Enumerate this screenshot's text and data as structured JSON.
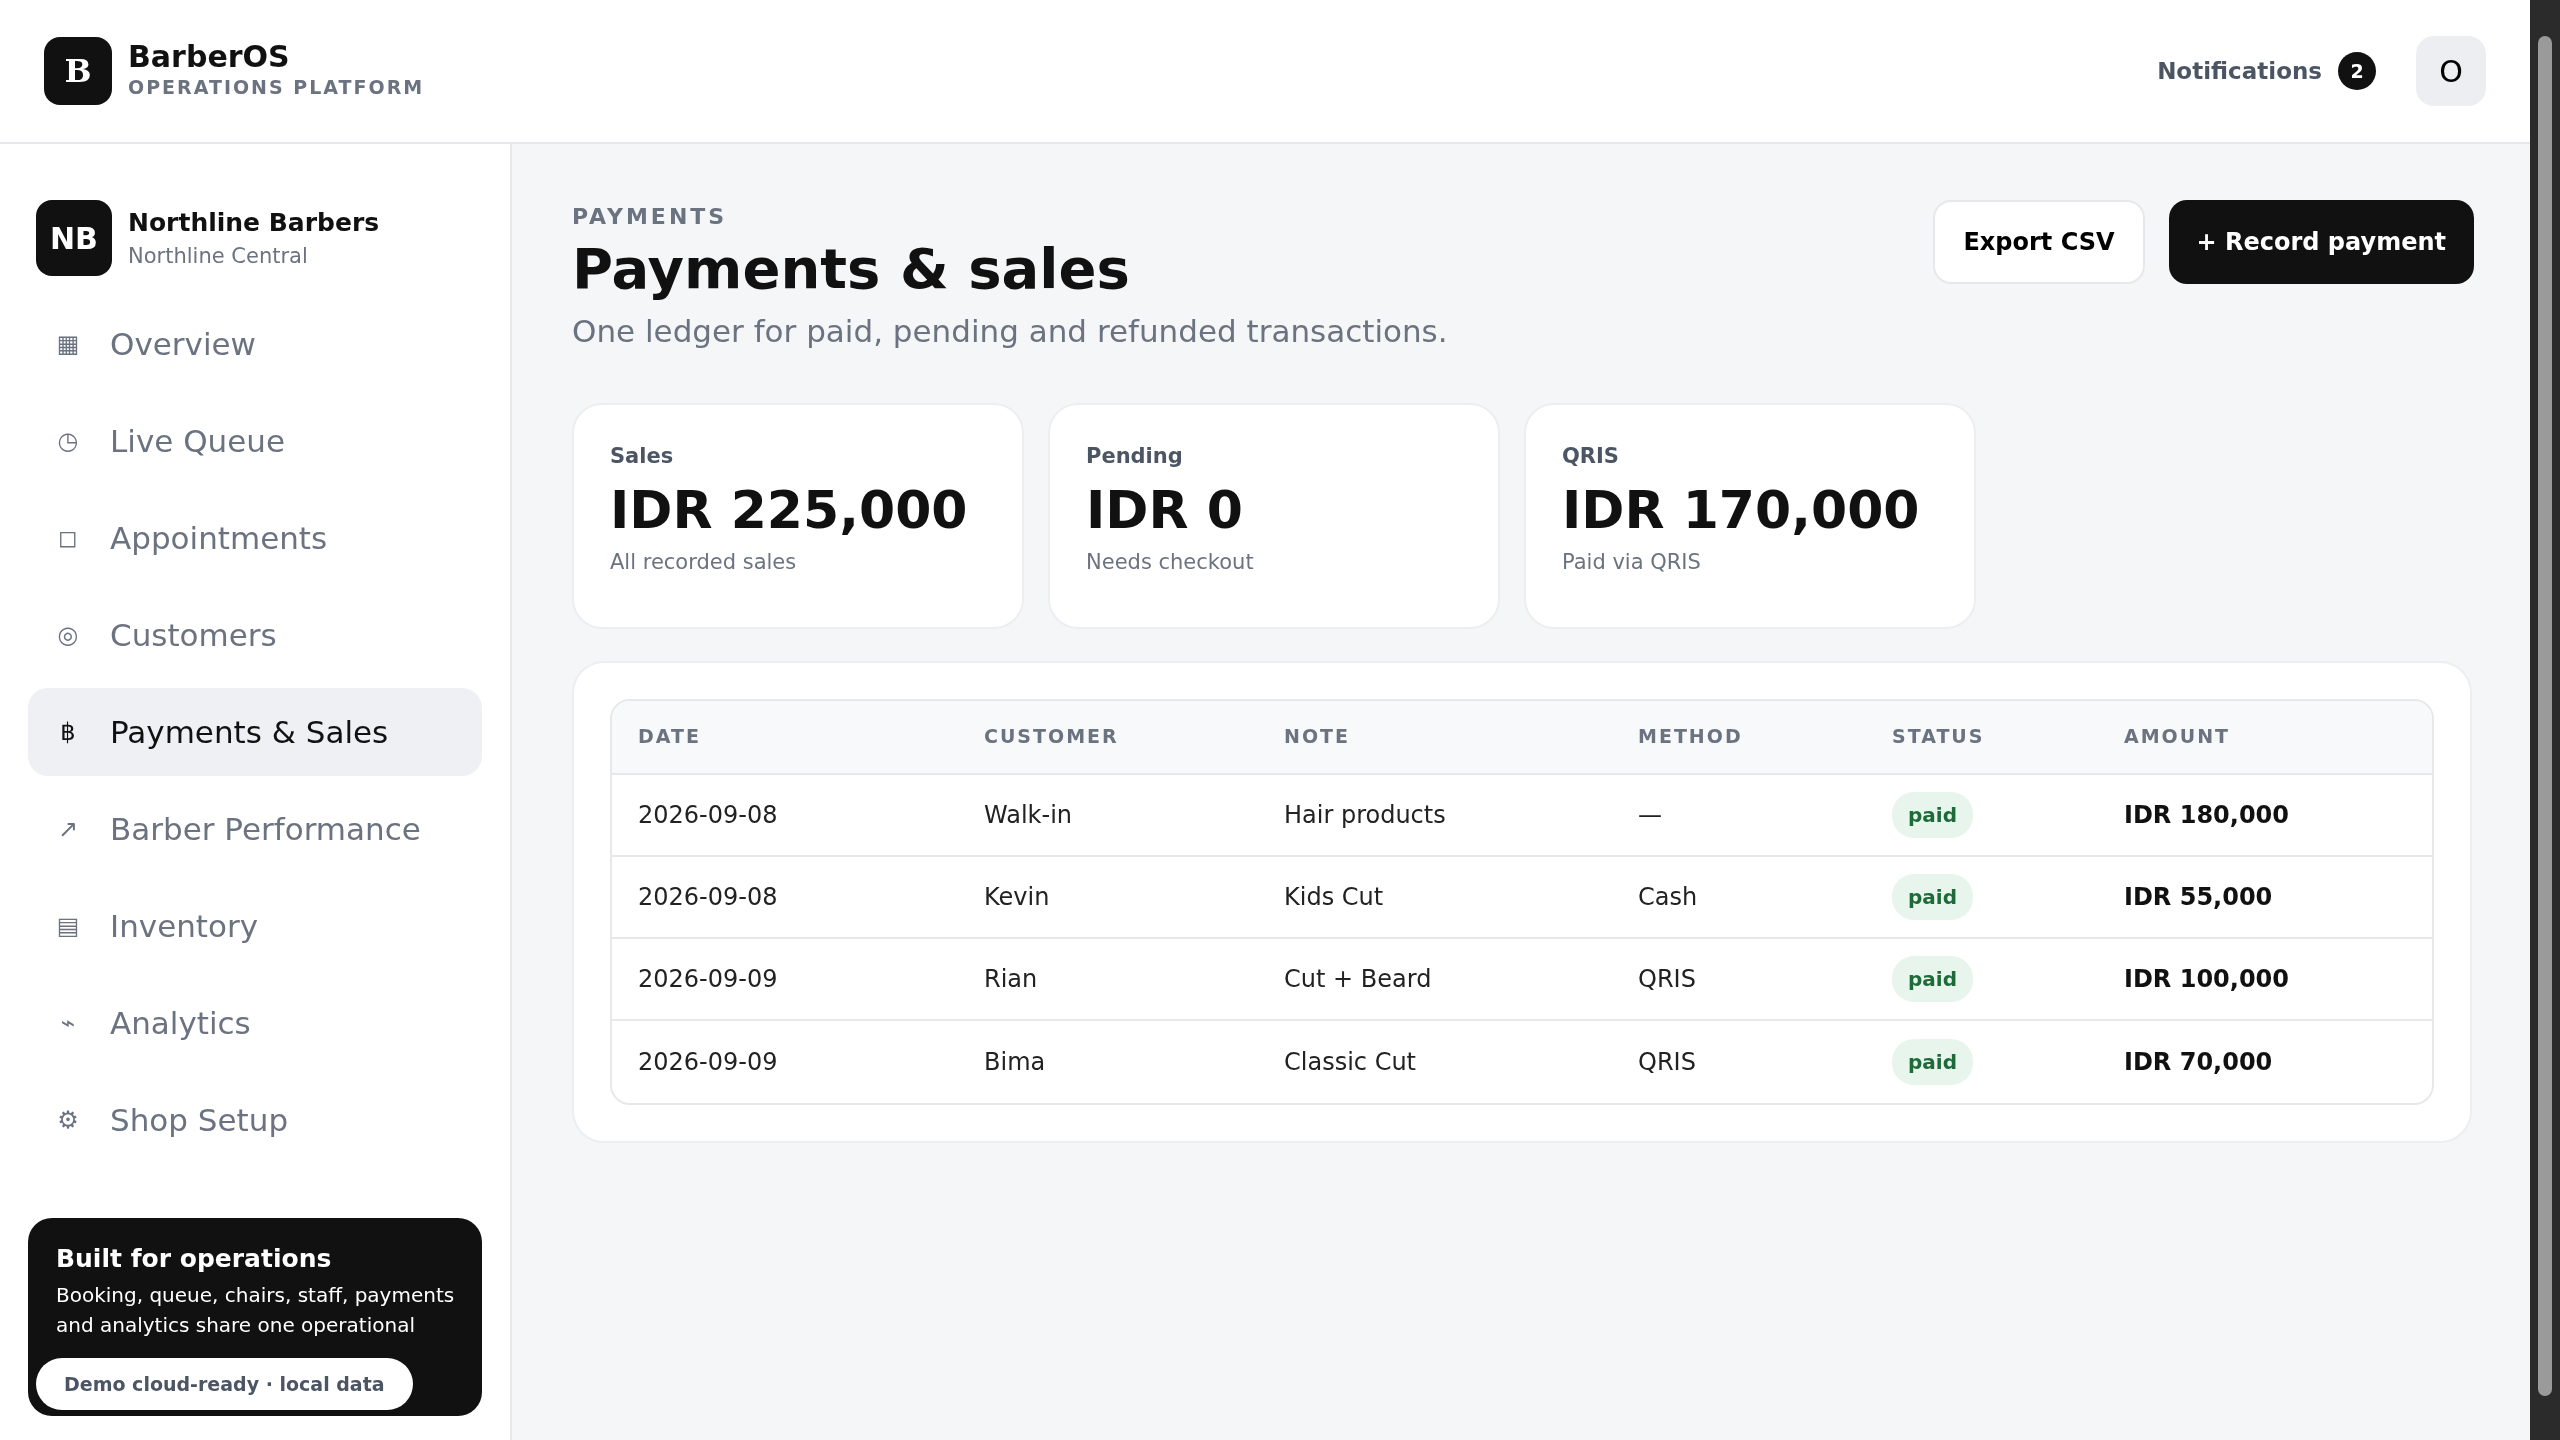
{
  "brand": {
    "logo": "B",
    "name": "BarberOS",
    "tagline": "OPERATIONS PLATFORM"
  },
  "topbar": {
    "notifications": "Notifications",
    "notification_count": "2",
    "avatar": "O"
  },
  "shop": {
    "initials": "NB",
    "name": "Northline Barbers",
    "location": "Northline Central"
  },
  "nav": [
    {
      "icon": "▦",
      "label": "Overview",
      "selected": false
    },
    {
      "icon": "◷",
      "label": "Live Queue",
      "selected": false
    },
    {
      "icon": "◻",
      "label": "Appointments",
      "selected": false
    },
    {
      "icon": "◎",
      "label": "Customers",
      "selected": false
    },
    {
      "icon": "฿",
      "label": "Payments & Sales",
      "selected": true
    },
    {
      "icon": "↗",
      "label": "Barber Performance",
      "selected": false
    },
    {
      "icon": "▤",
      "label": "Inventory",
      "selected": false
    },
    {
      "icon": "⌁",
      "label": "Analytics",
      "selected": false
    },
    {
      "icon": "⚙",
      "label": "Shop Setup",
      "selected": false
    }
  ],
  "promo": {
    "title": "Built for operations",
    "text": "Booking, queue, chairs, staff, payments and analytics share one operational",
    "pill": "Demo cloud-ready · local data"
  },
  "page": {
    "eyebrow": "PAYMENTS",
    "title": "Payments & sales",
    "subtitle": "One ledger for paid, pending and refunded transactions.",
    "buttons": [
      {
        "label": "Export CSV",
        "kind": "outline"
      },
      {
        "label": "+ Record payment",
        "kind": "primary"
      }
    ]
  },
  "stats": [
    {
      "label": "Sales",
      "value": "IDR 225,000",
      "note": "All recorded sales"
    },
    {
      "label": "Pending",
      "value": "IDR 0",
      "note": "Needs checkout"
    },
    {
      "label": "QRIS",
      "value": "IDR 170,000",
      "note": "Paid via QRIS"
    }
  ],
  "table": {
    "columns": [
      "DATE",
      "CUSTOMER",
      "NOTE",
      "METHOD",
      "STATUS",
      "AMOUNT"
    ],
    "rows": [
      [
        "2026-09-08",
        "Walk-in",
        "Hair products",
        "—",
        "paid",
        "IDR 180,000"
      ],
      [
        "2026-09-08",
        "Kevin",
        "Kids Cut",
        "Cash",
        "paid",
        "IDR 55,000"
      ],
      [
        "2026-09-09",
        "Rian",
        "Cut + Beard",
        "QRIS",
        "paid",
        "IDR 100,000"
      ],
      [
        "2026-09-09",
        "Bima",
        "Classic Cut",
        "QRIS",
        "paid",
        "IDR 70,000"
      ]
    ]
  }
}
